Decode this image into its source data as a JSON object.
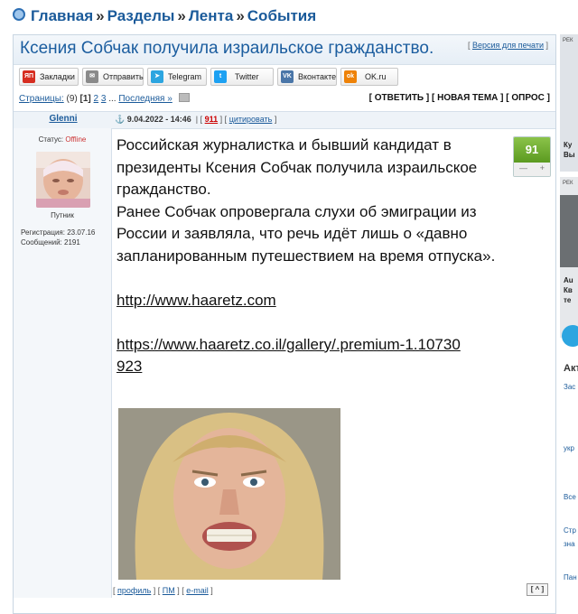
{
  "breadcrumb": {
    "items": [
      "Главная",
      "Разделы",
      "Лента",
      "События"
    ],
    "separator": "»"
  },
  "topic": {
    "title": "Ксения Собчак получила израильское гражданство.",
    "print_label": "Версия для печати"
  },
  "share": {
    "buttons": [
      {
        "label": "Закладки",
        "icon": "yap-icon",
        "color": "#d62d20",
        "glyph": "ЯП"
      },
      {
        "label": "Отправить",
        "icon": "mail-icon",
        "color": "#8a8a8a",
        "glyph": "✉"
      },
      {
        "label": "Telegram",
        "icon": "telegram-icon",
        "color": "#2ca5e0",
        "glyph": "➤"
      },
      {
        "label": "Twitter",
        "icon": "twitter-icon",
        "color": "#1da1f2",
        "glyph": "t"
      },
      {
        "label": "Вконтакте",
        "icon": "vk-icon",
        "color": "#4a76a8",
        "glyph": "VK"
      },
      {
        "label": "OK.ru",
        "icon": "ok-icon",
        "color": "#ee8208",
        "glyph": "ok"
      }
    ]
  },
  "pager": {
    "label": "Страницы:",
    "count": "(9)",
    "current": "[1]",
    "pages": [
      "2",
      "3"
    ],
    "ellipsis": "...",
    "last": "Последняя »"
  },
  "actions": {
    "reply": "ОТВЕТИТЬ",
    "new_topic": "НОВАЯ ТЕМА",
    "poll": "ОПРОС"
  },
  "post": {
    "author": "Glenni",
    "date": "9.04.2022 - 14:46",
    "number": "911",
    "cite": "цитировать",
    "status_label": "Статус:",
    "status_value": "Offline",
    "role": "Путник",
    "reg_label": "Регистрация:",
    "reg_date": "23.07.16",
    "msgs_label": "Сообщений:",
    "msgs_count": "2191",
    "rating": "91",
    "rating_minus": "—",
    "rating_plus": "+",
    "paragraph1": "Российская журналистка и бывший кандидат в президенты Ксения Собчак получила израильское гражданство.",
    "paragraph2": "Ранее Собчак опровергала слухи об эмиграции из России и заявляла, что речь идёт лишь о «давно запланированным путешествием на время отпуска».",
    "link1": "http://www.haaretz.com",
    "link2": "https://www.haaretz.co.il/gallery/.premium-1.10730923",
    "footer_profile": "профиль",
    "footer_pm": "ПМ",
    "footer_email": "e-mail",
    "up_label": "[ ^ ]"
  },
  "sidebar": {
    "ad_label": "РЕК",
    "fragments": [
      "Ку",
      "Вы",
      "Au",
      "Кв",
      "те",
      "Акт",
      "Зас",
      "укр",
      "Все",
      "Стр",
      "зна",
      "Пан"
    ]
  }
}
